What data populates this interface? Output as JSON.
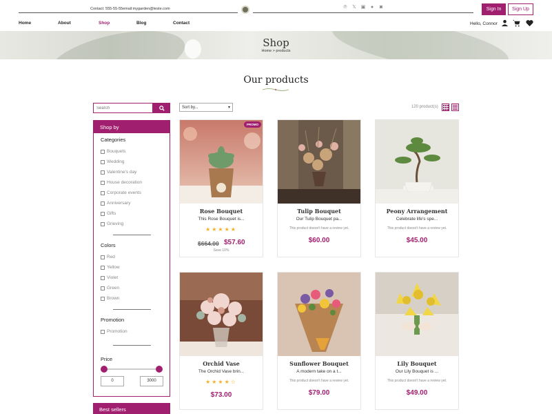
{
  "topbar": {
    "contact": "Contact: 555-55-55",
    "email": "email:mygarden@teste.com",
    "social_icons": [
      "pinterest-icon",
      "x-icon",
      "linkedin-icon",
      "facebook-icon",
      "instagram-icon"
    ],
    "signin_label": "Sign In",
    "signup_label": "Sign Up"
  },
  "nav": {
    "items": [
      "Home",
      "About",
      "Shop",
      "Blog",
      "Contact"
    ],
    "active": "Shop",
    "greeting": "Hello, Connor"
  },
  "hero": {
    "title": "Shop",
    "breadcrumb": "Home > products"
  },
  "main": {
    "section_title": "Our products",
    "search_placeholder": "Search",
    "sort_label": "Sort by...",
    "count_label": "120 product(s)"
  },
  "sidebar": {
    "header": "Shop by",
    "categories_title": "Categories",
    "categories": [
      "Bouquets",
      "Wedding",
      "Valentine's day",
      "House decoration",
      "Corporate events",
      "Anniversary",
      "Gifts",
      "Grieving"
    ],
    "colors_title": "Colors",
    "colors": [
      "Red",
      "Yellow",
      "Violet",
      "Green",
      "Brown"
    ],
    "promotion_title": "Promotion",
    "promotion_option": "Promotion",
    "price_title": "Price",
    "price_min": "0",
    "price_max": "3000",
    "bestsellers": "Best sellers"
  },
  "products": [
    {
      "name": "Rose Bouquet",
      "desc": "This Rose Bouquet is...",
      "rating": 5,
      "old_price": "$664.00",
      "price": "$57.60",
      "save": "Save 10%",
      "promo": "PROMO"
    },
    {
      "name": "Tulip Bouquet",
      "desc": "Our Tulip Bouquet pa...",
      "no_review": "This product doesn't have a review yet.",
      "price": "$60.00"
    },
    {
      "name": "Peony Arrangement",
      "desc": "Celebrate life's spe...",
      "no_review": "This product doesn't have a review yet.",
      "price": "$45.00"
    },
    {
      "name": "Orchid Vase",
      "desc": "The Orchid Vase brin...",
      "rating": 4,
      "price": "$73.00"
    },
    {
      "name": "Sunflower Bouquet",
      "desc": "A modern take on a t...",
      "no_review": "This product doesn't have a review yet.",
      "price": "$79.00"
    },
    {
      "name": "Lily Bouquet",
      "desc": "Our Lily Bouquet is ...",
      "no_review": "This product doesn't have a review yet.",
      "price": "$49.00"
    }
  ],
  "stars": {
    "five": "★★★★★",
    "four": "★★★★☆"
  },
  "colors": {
    "accent": "#a11f6f",
    "star": "#f2b01e"
  }
}
